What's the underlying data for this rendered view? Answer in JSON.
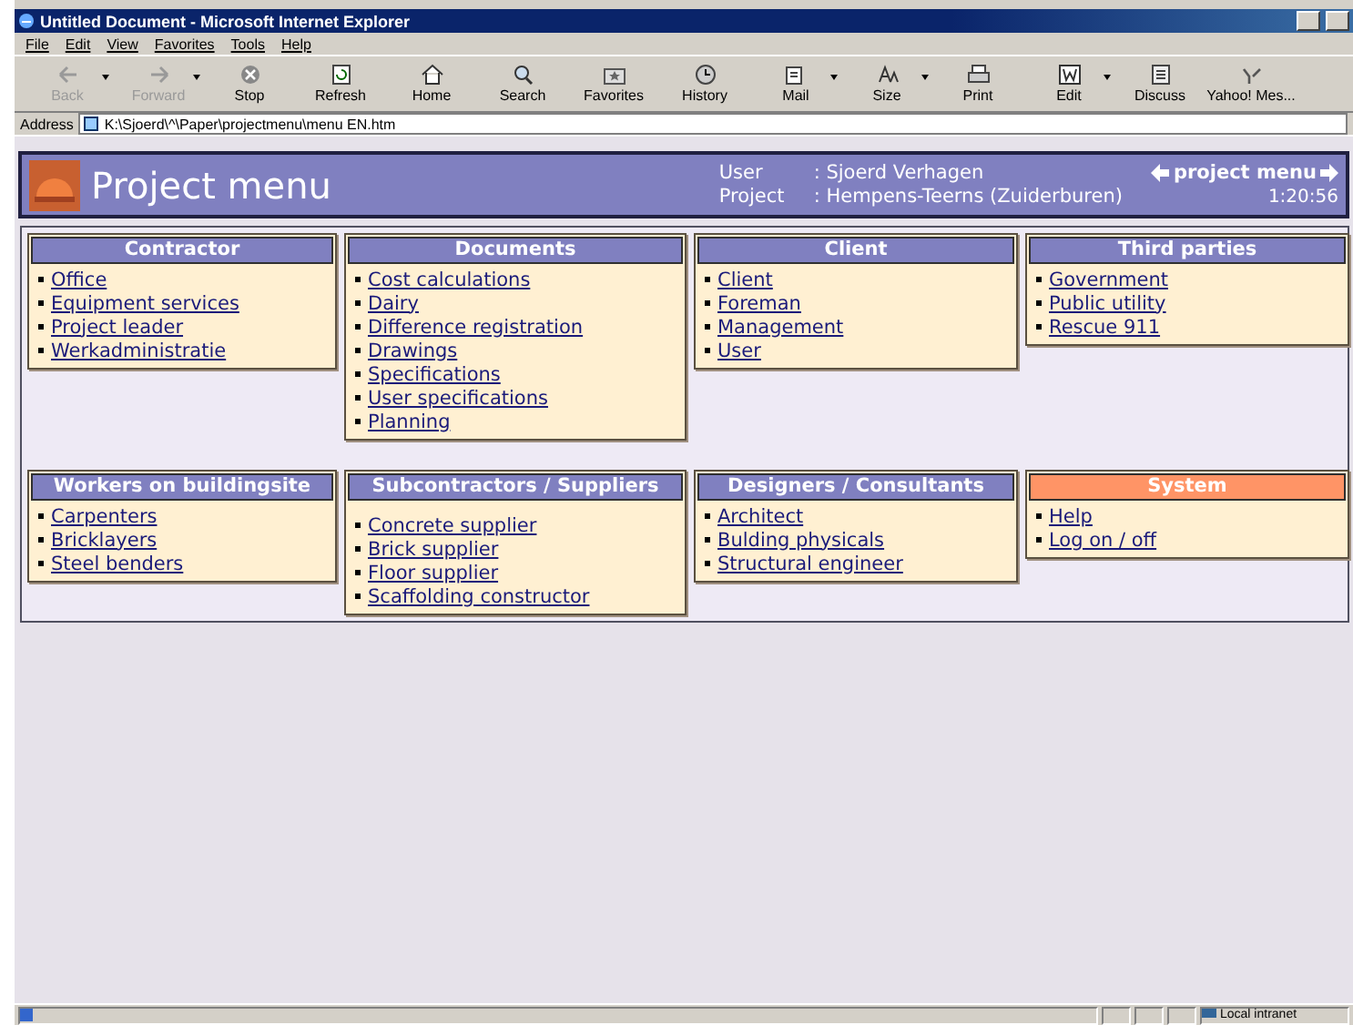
{
  "window": {
    "title": "Untitled Document - Microsoft Internet Explorer"
  },
  "menu": [
    "File",
    "Edit",
    "View",
    "Favorites",
    "Tools",
    "Help"
  ],
  "toolbar": [
    {
      "label": "Back",
      "kind": "back",
      "disabled": true,
      "dropdown": true
    },
    {
      "label": "Forward",
      "kind": "forward",
      "disabled": true,
      "dropdown": true
    },
    {
      "label": "Stop",
      "kind": "stop",
      "disabled": false,
      "dropdown": false
    },
    {
      "label": "Refresh",
      "kind": "refresh",
      "disabled": false,
      "dropdown": false
    },
    {
      "label": "Home",
      "kind": "home",
      "disabled": false,
      "dropdown": false
    },
    {
      "label": "Search",
      "kind": "search",
      "disabled": false,
      "dropdown": false
    },
    {
      "label": "Favorites",
      "kind": "favorites",
      "disabled": false,
      "dropdown": false
    },
    {
      "label": "History",
      "kind": "history",
      "disabled": false,
      "dropdown": false
    },
    {
      "label": "Mail",
      "kind": "mail",
      "disabled": false,
      "dropdown": true
    },
    {
      "label": "Size",
      "kind": "size",
      "disabled": false,
      "dropdown": true
    },
    {
      "label": "Print",
      "kind": "print",
      "disabled": false,
      "dropdown": false
    },
    {
      "label": "Edit",
      "kind": "edit",
      "disabled": false,
      "dropdown": true
    },
    {
      "label": "Discuss",
      "kind": "discuss",
      "disabled": false,
      "dropdown": false
    },
    {
      "label": "Yahoo! Mes...",
      "kind": "messenger",
      "disabled": false,
      "dropdown": false
    }
  ],
  "address": {
    "label": "Address",
    "value": "K:\\Sjoerd\\^\\Paper\\projectmenu\\menu EN.htm"
  },
  "header": {
    "title": "Project menu",
    "user_label": "User",
    "user": ": Sjoerd Verhagen",
    "project_label": "Project",
    "project": ": Hempens-Teerns (Zuiderburen)",
    "nav": "project menu",
    "time": "1:20:56"
  },
  "sections": [
    {
      "title": "Contractor",
      "color": "#8080c0",
      "links": [
        "Office",
        "Equipment services",
        "Project leader",
        "Werkadministratie"
      ]
    },
    {
      "title": "Documents",
      "color": "#8080c0",
      "links": [
        "Cost calculations",
        "Dairy",
        "Difference registration",
        "Drawings",
        "Specifications",
        "User specifications",
        "Planning"
      ]
    },
    {
      "title": "Client",
      "color": "#8080c0",
      "links": [
        "Client",
        "Foreman",
        "Management",
        "User"
      ]
    },
    {
      "title": "Third parties",
      "color": "#8080c0",
      "links": [
        "Government",
        "Public utility",
        "Rescue 911"
      ]
    },
    {
      "title": "Workers on buildingsite",
      "color": "#8080c0",
      "links": [
        "Carpenters",
        "Bricklayers",
        "Steel benders"
      ]
    },
    {
      "title": "Subcontractors / Suppliers",
      "color": "#8080c0",
      "links": [
        "Concrete supplier",
        "Brick supplier",
        "Floor supplier",
        "Scaffolding constructor"
      ]
    },
    {
      "title": "Designers / Consultants",
      "color": "#8080c0",
      "links": [
        "Architect",
        "Bulding physicals",
        "Structural engineer"
      ]
    },
    {
      "title": "System",
      "color": "#ff9466",
      "links": [
        "Help",
        "Log on / off"
      ]
    }
  ],
  "status_bar": {
    "zone": "Local intranet"
  }
}
